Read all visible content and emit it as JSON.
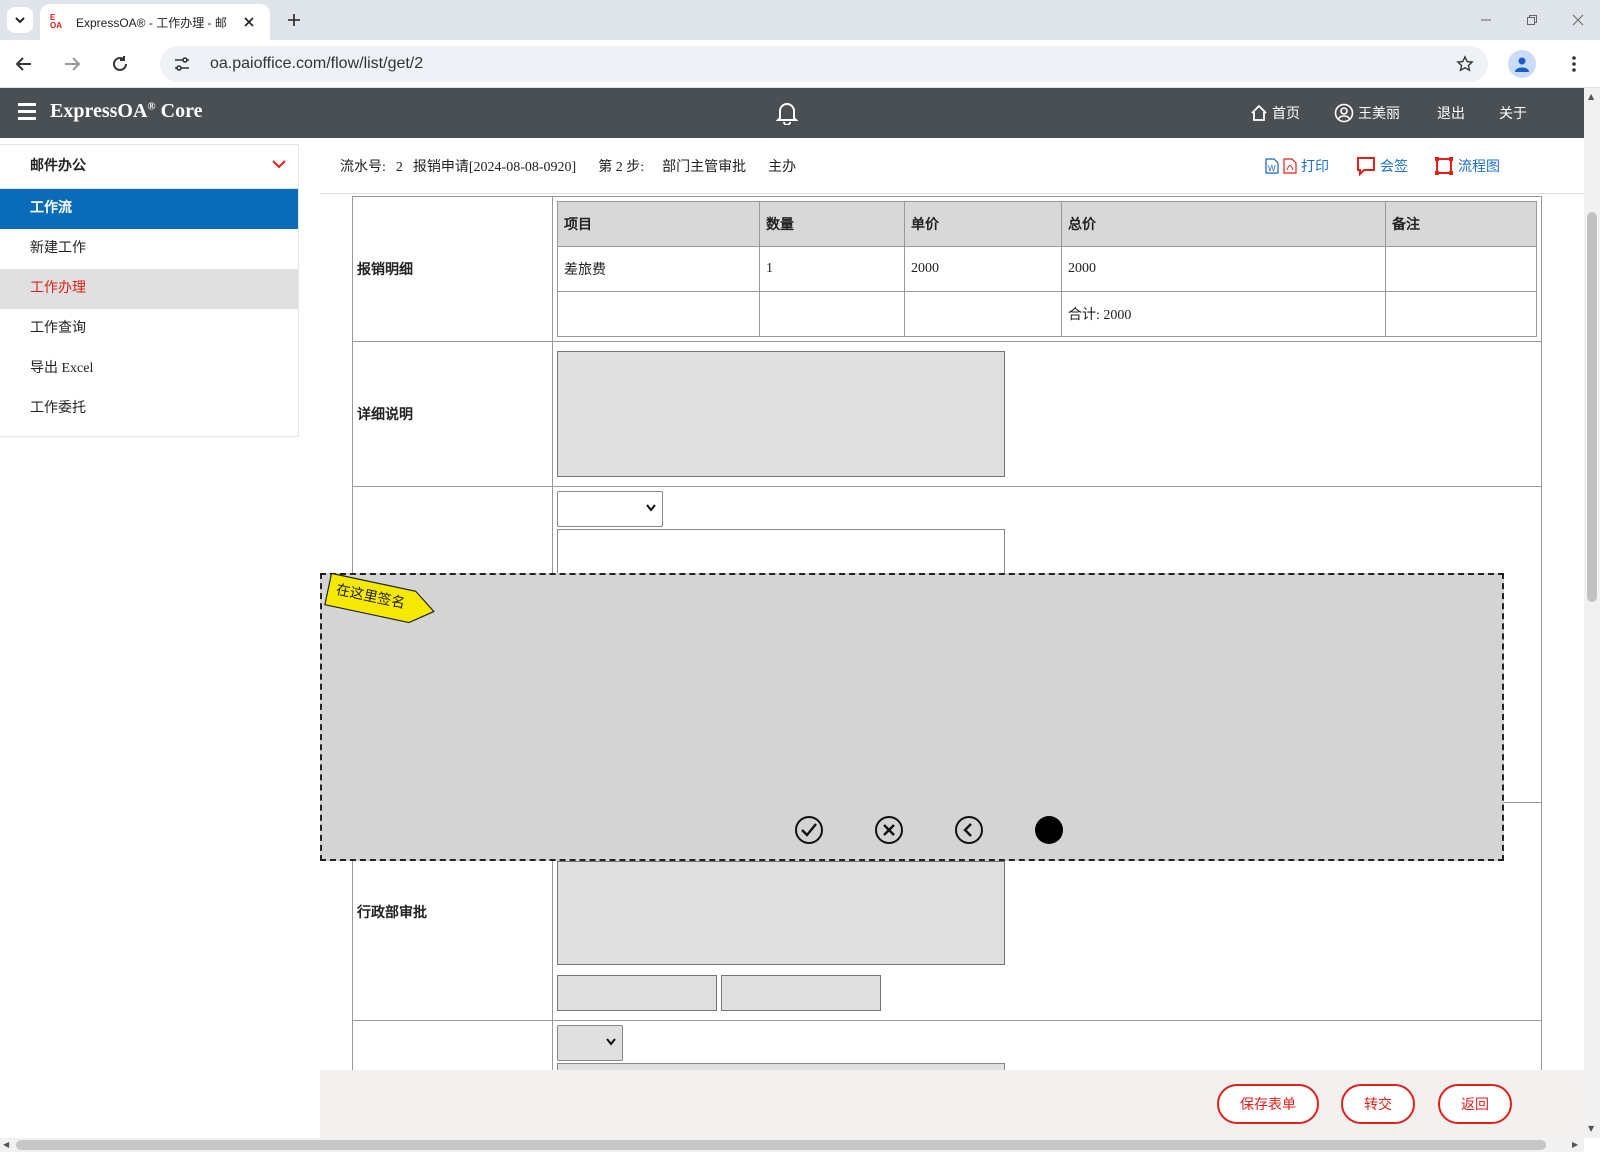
{
  "browser": {
    "tab_title": "ExpressOA® - 工作办理 - 邮",
    "favicon_text": "E OA",
    "url": "oa.paioffice.com/flow/list/get/2"
  },
  "header": {
    "brand": "ExpressOA",
    "brand_suffix": "Core",
    "nav": {
      "home": "首页",
      "user": "王美丽",
      "logout": "退出",
      "about": "关于"
    }
  },
  "sidebar": {
    "section": "邮件办公",
    "items": [
      {
        "label": "工作流"
      },
      {
        "label": "新建工作"
      },
      {
        "label": "工作办理"
      },
      {
        "label": "工作查询"
      },
      {
        "label": "导出 Excel"
      },
      {
        "label": "工作委托"
      }
    ]
  },
  "info": {
    "serial_label": "流水号:",
    "serial_value": "2",
    "title": "报销申请[2024-08-08-0920]",
    "step": "第 2 步:",
    "step_name": "部门主管审批",
    "role": "主办",
    "print": "打印",
    "countersign": "会签",
    "flowchart": "流程图"
  },
  "form": {
    "detail_label": "报销明细",
    "detail_headers": [
      "项目",
      "数量",
      "单价",
      "总价",
      "备注"
    ],
    "detail_rows": [
      [
        "差旅费",
        "1",
        "2000",
        "2000",
        ""
      ],
      [
        "",
        "",
        "",
        "合计: 2000",
        ""
      ]
    ],
    "description_label": "详细说明",
    "admin_label": "行政部审批"
  },
  "signature": {
    "tag": "在这里签名",
    "tools": [
      "confirm-icon",
      "clear-icon",
      "undo-icon",
      "pen-color-icon"
    ]
  },
  "footer": {
    "save": "保存表单",
    "transfer": "转交",
    "back": "返回"
  }
}
